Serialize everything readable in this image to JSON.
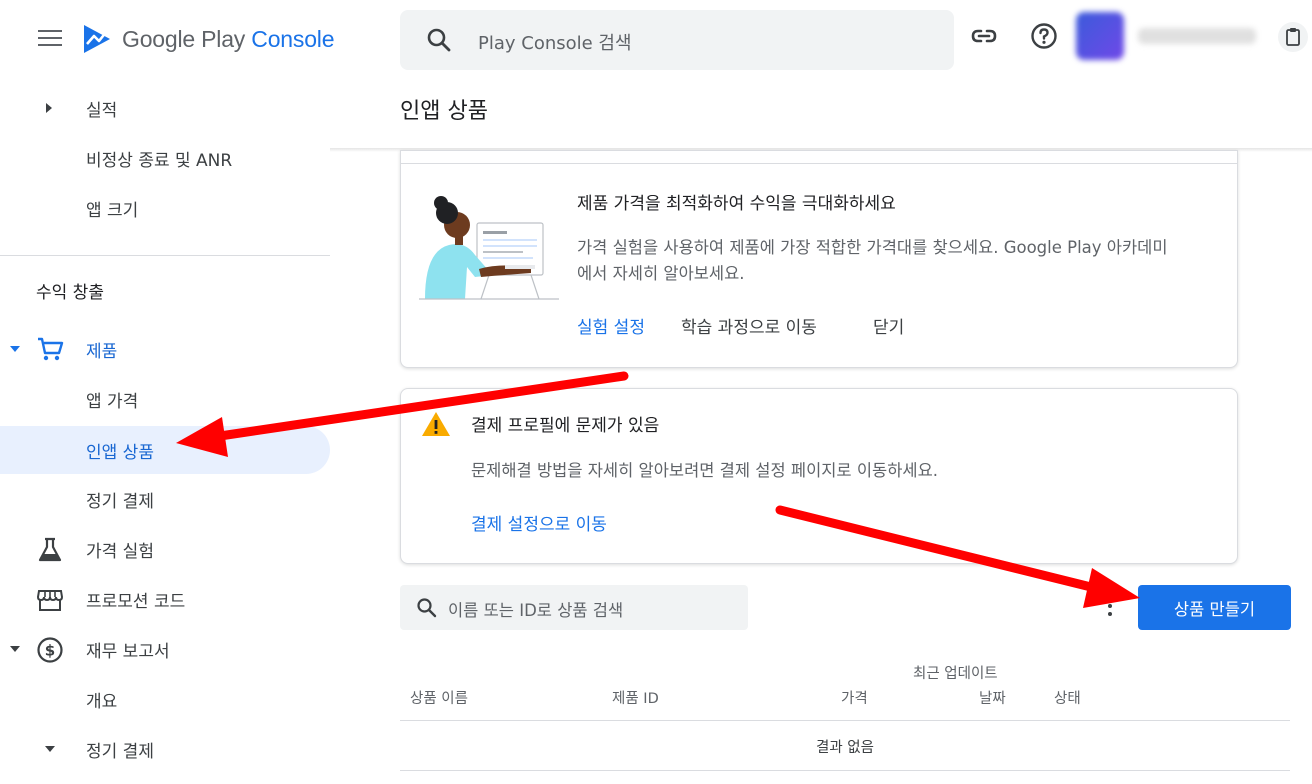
{
  "app": {
    "brand_google_play": "Google Play ",
    "brand_console": "Console",
    "brand_color": "#1a73e8"
  },
  "topbar": {
    "search_placeholder": "Play Console 검색",
    "icons": [
      "search-icon",
      "link-icon",
      "help-icon",
      "account-menu-icon"
    ]
  },
  "sidebar": {
    "items": [
      {
        "label": "실적"
      },
      {
        "label": "비정상 종료 및 ANR"
      },
      {
        "label": "앱 크기"
      }
    ],
    "section_monetization": "수익 창출",
    "monetization": [
      {
        "label": "제품"
      },
      {
        "label": "앱 가격"
      },
      {
        "label": "인앱 상품"
      },
      {
        "label": "정기 결제"
      },
      {
        "label": "가격 실험"
      },
      {
        "label": "프로모션 코드"
      },
      {
        "label": "재무 보고서"
      },
      {
        "label": "개요"
      },
      {
        "label": "정기 결제"
      }
    ]
  },
  "page": {
    "title": "인앱 상품"
  },
  "pricing_card": {
    "title": "제품 가격을 최적화하여 수익을 극대화하세요",
    "body": "가격 실험을 사용하여 제품에 가장 적합한 가격대를 찾으세요. Google Play 아카데미에서 자세히 알아보세요.",
    "action_setup": "실험 설정",
    "action_course": "학습 과정으로 이동",
    "action_close": "닫기"
  },
  "payment_card": {
    "title": "결제 프로필에 문제가 있음",
    "body": "문제해결 방법을 자세히 알아보려면 결제 설정 페이지로 이동하세요.",
    "action": "결제 설정으로 이동"
  },
  "products": {
    "search_placeholder": "이름 또는 ID로 상품 검색",
    "create_button": "상품 만들기",
    "columns": {
      "name": "상품 이름",
      "product_id": "제품 ID",
      "price": "가격",
      "updated_line1": "최근 업데이트",
      "updated_line2": "날짜",
      "status": "상태"
    },
    "empty_text": "결과 없음"
  },
  "colors": {
    "accent": "#1a73e8",
    "active_bg": "#e8f0fe",
    "warning": "#f9ab00",
    "annotation": "#ff0000"
  }
}
